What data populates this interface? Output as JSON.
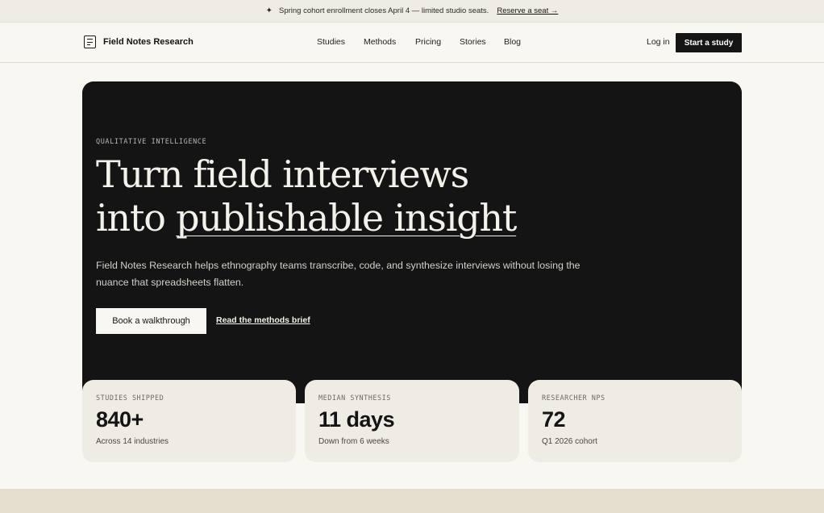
{
  "announcement": {
    "icon": "sparkle-icon",
    "text": "Spring cohort enrollment closes April 4 — limited studio seats.",
    "link": "Reserve a seat →"
  },
  "nav": {
    "brand": "Field Notes Research",
    "links": [
      "Studies",
      "Methods",
      "Pricing",
      "Stories",
      "Blog"
    ],
    "login": "Log in",
    "cta": "Start a study"
  },
  "hero": {
    "eyebrow": "QUALITATIVE INTELLIGENCE",
    "headline_line1": "Turn field interviews",
    "headline_line2_prefix": "into ",
    "headline_line2_underlined": "publishable insight",
    "lede": "Field Notes Research helps ethnography teams transcribe, code, and synthesize interviews without losing the nuance that spreadsheets flatten.",
    "primary_button": "Book a walkthrough",
    "secondary_link": "Read the methods brief"
  },
  "stats": [
    {
      "label": "STUDIES SHIPPED",
      "value": "840+",
      "sub": "Across 14 industries"
    },
    {
      "label": "MEDIAN SYNTHESIS",
      "value": "11 days",
      "sub": "Down from 6 weeks"
    },
    {
      "label": "RESEARCHER NPS",
      "value": "72",
      "sub": "Q1 2026 cohort"
    }
  ],
  "colors": {
    "background": "#f9f7f2",
    "hero": "#141414",
    "card": "#efece4",
    "footer_band": "#e5ddcd"
  }
}
